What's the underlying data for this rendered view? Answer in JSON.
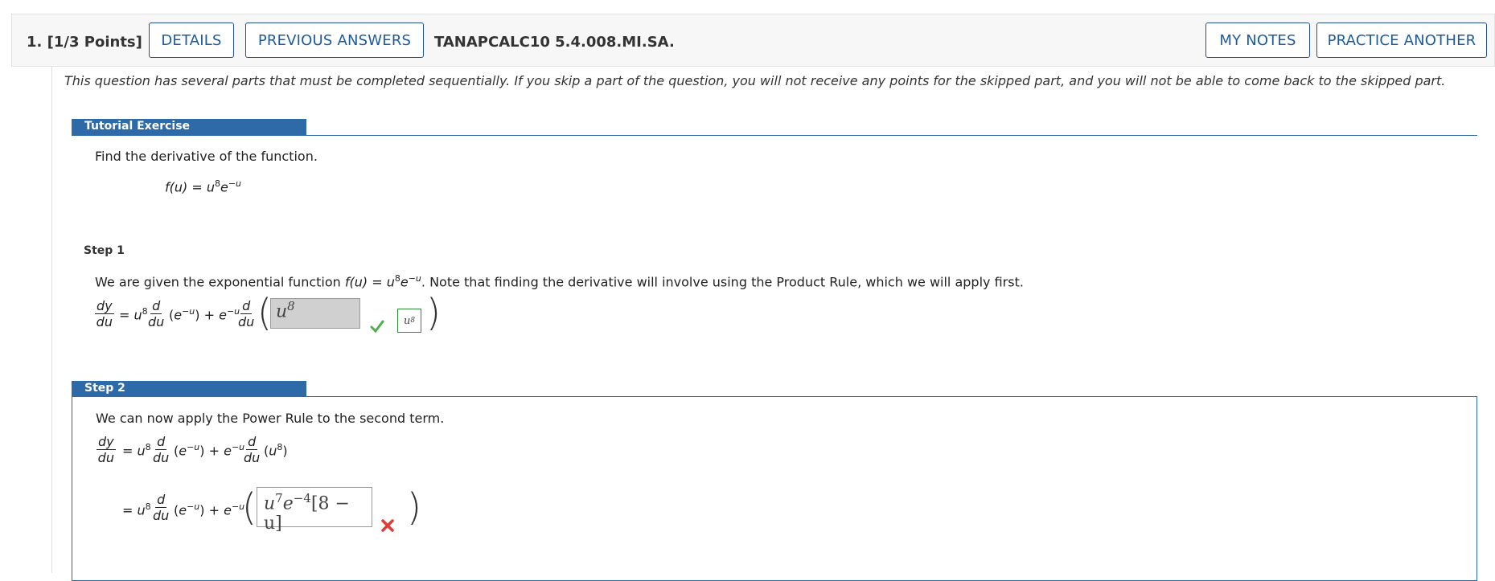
{
  "header": {
    "question_number": "1.",
    "points": "[1/3 Points]",
    "details_label": "DETAILS",
    "previous_answers_label": "PREVIOUS ANSWERS",
    "question_id": "TANAPCALC10 5.4.008.MI.SA.",
    "my_notes_label": "MY NOTES",
    "practice_another_label": "PRACTICE ANOTHER"
  },
  "instructions": "This question has several parts that must be completed sequentially. If you skip a part of the question, you will not receive any points for the skipped part, and you will not be able to come back to the skipped part.",
  "tutorial": {
    "tab_label": "Tutorial Exercise",
    "prompt": "Find the derivative of the function.",
    "function_lhs": "f(u) = u",
    "function_exp1": "8",
    "function_mid": "e",
    "function_exp2": "−u"
  },
  "step1": {
    "label": "Step 1",
    "text_before": "We are given the exponential function ",
    "text_func": "f(u) = u",
    "text_exp1": "8",
    "text_func2": "e",
    "text_exp2": "−u",
    "text_after": ". Note that finding the derivative will involve using the Product Rule, which we will apply first.",
    "answer_value": "u",
    "answer_exp": "8",
    "correct_value": "u",
    "correct_exp": "8"
  },
  "step2": {
    "label": "Step 2",
    "text": "We can now apply the Power Rule to the second term.",
    "answer_value": "u",
    "answer_exp1": "7",
    "answer_mid": "e",
    "answer_exp2": "−4",
    "answer_bracket": "[8 − u]"
  },
  "colors": {
    "accent": "#2e6aa8",
    "button_border": "#24508a",
    "correct": "#4caf50",
    "incorrect": "#e53935"
  },
  "icons": {
    "correct": "checkmark-icon",
    "incorrect": "x-mark-icon"
  }
}
